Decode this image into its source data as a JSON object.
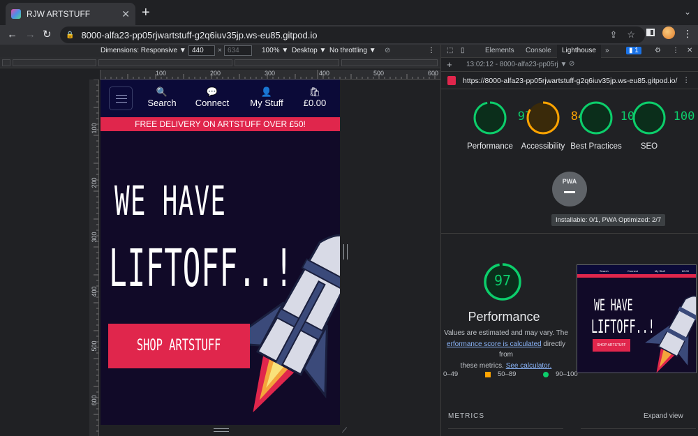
{
  "browser": {
    "tab_title": "RJW ARTSTUFF",
    "close_label": "✕",
    "newtab_label": "+",
    "url": "8000-alfa23-pp05rjwartstuff-g2q6iuv35jp.ws-eu85.gitpod.io"
  },
  "device_toolbar": {
    "dimensions": "Dimensions: Responsive ▼",
    "width": "440",
    "times": "×",
    "height": "634",
    "zoom": "100% ▼",
    "device_type": "Desktop ▼",
    "throttling": "No throttling ▼"
  },
  "rulers": {
    "h": [
      "100",
      "200",
      "300",
      "400",
      "500",
      "600"
    ],
    "v": [
      "100",
      "200",
      "300",
      "400",
      "500",
      "600"
    ]
  },
  "site": {
    "nav": [
      {
        "icon": "🔍",
        "label": "Search"
      },
      {
        "icon": "💬",
        "label": "Connect"
      },
      {
        "icon": "👤",
        "label": "My Stuff"
      },
      {
        "icon": "🛍",
        "label": "£0.00"
      }
    ],
    "promo": "FREE DELIVERY ON ARTSTUFF OVER £50!",
    "headline_1": "WE HAVE",
    "headline_2": "LIFTOFF..!",
    "cta": "SHOP ARTSTUFF"
  },
  "devtools": {
    "tabs": [
      "Elements",
      "Console",
      "Lighthouse"
    ],
    "more": "»",
    "issues_count": "1",
    "report_label": "13:02:12 - 8000-alfa23-pp05rj ▼",
    "report_url": "https://8000-alfa23-pp05rjwartstuff-g2q6iuv35jp.ws-eu85.gitpod.io/",
    "scores": [
      {
        "value": "97",
        "label": "Performance",
        "color": "#0cce6b"
      },
      {
        "value": "84",
        "label": "Accessibility",
        "color": "#ffa400"
      },
      {
        "value": "100",
        "label": "Best Practices",
        "color": "#0cce6b"
      },
      {
        "value": "100",
        "label": "SEO",
        "color": "#0cce6b"
      }
    ],
    "pwa_label": "PWA",
    "pwa_tooltip": "Installable: 0/1, PWA Optimized: 2/7",
    "perf_score": "97",
    "perf_title": "Performance",
    "perf_desc_1": "Values are estimated and may vary. The",
    "perf_link": "erformance score is calculated",
    "perf_desc_2": "directly from",
    "perf_desc_3": "these metrics.",
    "perf_calc_link": "See calculator.",
    "legend": [
      {
        "range": "0–49",
        "color": "#ff4e42"
      },
      {
        "range": "50–89",
        "color": "#ffa400"
      },
      {
        "range": "90–100",
        "color": "#0cce6b"
      }
    ],
    "metrics_label": "METRICS",
    "expand_label": "Expand view",
    "thumb_headline_1": "WE HAVE",
    "thumb_headline_2": "LIFTOFF..!",
    "thumb_cta": "SHOP ARTSTUFF",
    "thumb_nav": [
      "Search",
      "Connect",
      "My Stuff",
      "£0.00"
    ]
  }
}
